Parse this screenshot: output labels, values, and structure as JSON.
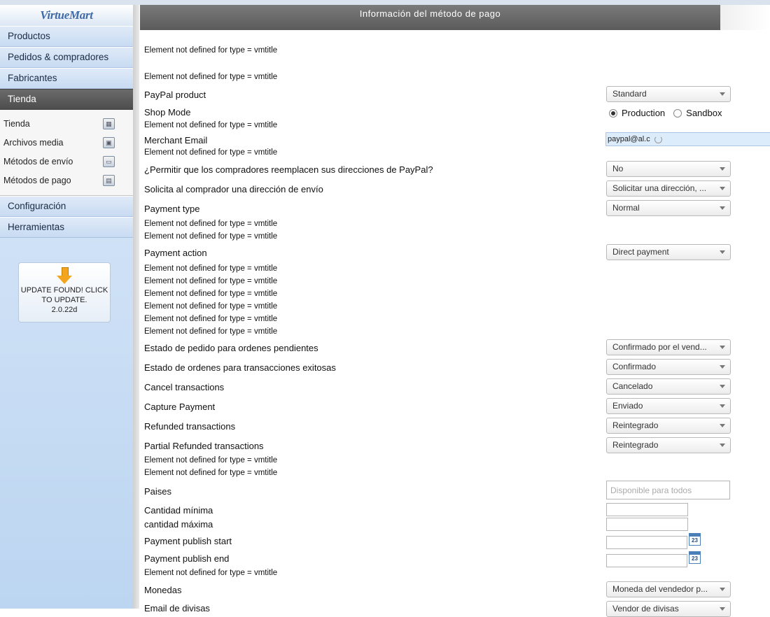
{
  "sidebar": {
    "logo": "VirtueMart",
    "menu_top": [
      "Productos",
      "Pedidos & compradores",
      "Fabricantes"
    ],
    "menu_active": "Tienda",
    "submenu": [
      {
        "label": "Tienda",
        "icon": "store-icon"
      },
      {
        "label": "Archivos media",
        "icon": "media-icon"
      },
      {
        "label": "Métodos de envío",
        "icon": "truck-icon"
      },
      {
        "label": "Métodos de pago",
        "icon": "payment-icon"
      }
    ],
    "menu_bottom": [
      "Configuración",
      "Herramientas"
    ],
    "update": {
      "line1": "UPDATE FOUND! CLICK",
      "line2": "TO UPDATE.",
      "version": "2.0.22d"
    }
  },
  "main": {
    "header_title": "Información del método de pago",
    "note_text": "Element not defined for type = vmtitle",
    "labels": {
      "paypal_product": "PayPal product",
      "shop_mode": "Shop Mode",
      "merchant_email": "Merchant Email",
      "allow_replace": "¿Permitir que los compradores reemplacen sus direcciones de PayPal?",
      "request_address": "Solicita al comprador una dirección de envío",
      "payment_type": "Payment type",
      "payment_action": "Payment action",
      "status_pending": "Estado de pedido para ordenes pendientes",
      "status_success": "Estado de ordenes para transacciones exitosas",
      "cancel_tx": "Cancel transactions",
      "capture": "Capture Payment",
      "refunded": "Refunded transactions",
      "partial_refunded": "Partial Refunded transactions",
      "countries": "Paises",
      "min_amount": "Cantidad mínima",
      "max_amount": "cantidad máxima",
      "publish_start": "Payment publish start",
      "publish_end": "Payment publish end",
      "currencies": "Monedas",
      "email_currency": "Email de divisas"
    },
    "values": {
      "paypal_product": "Standard",
      "shop_mode_production": "Production",
      "shop_mode_sandbox": "Sandbox",
      "merchant_email": "paypal@al.c",
      "allow_replace": "No",
      "request_address": "Solicitar una dirección, ...",
      "payment_type": "Normal",
      "payment_action": "Direct payment",
      "status_pending": "Confirmado por el vend...",
      "status_success": "Confirmado",
      "cancel_tx": "Cancelado",
      "capture": "Enviado",
      "refunded": "Reintegrado",
      "partial_refunded": "Reintegrado",
      "countries_placeholder": "Disponible para todos",
      "calendar_icon_text": "23",
      "currencies": "Moneda del vendedor p...",
      "email_currency": "Vendor de divisas"
    }
  }
}
